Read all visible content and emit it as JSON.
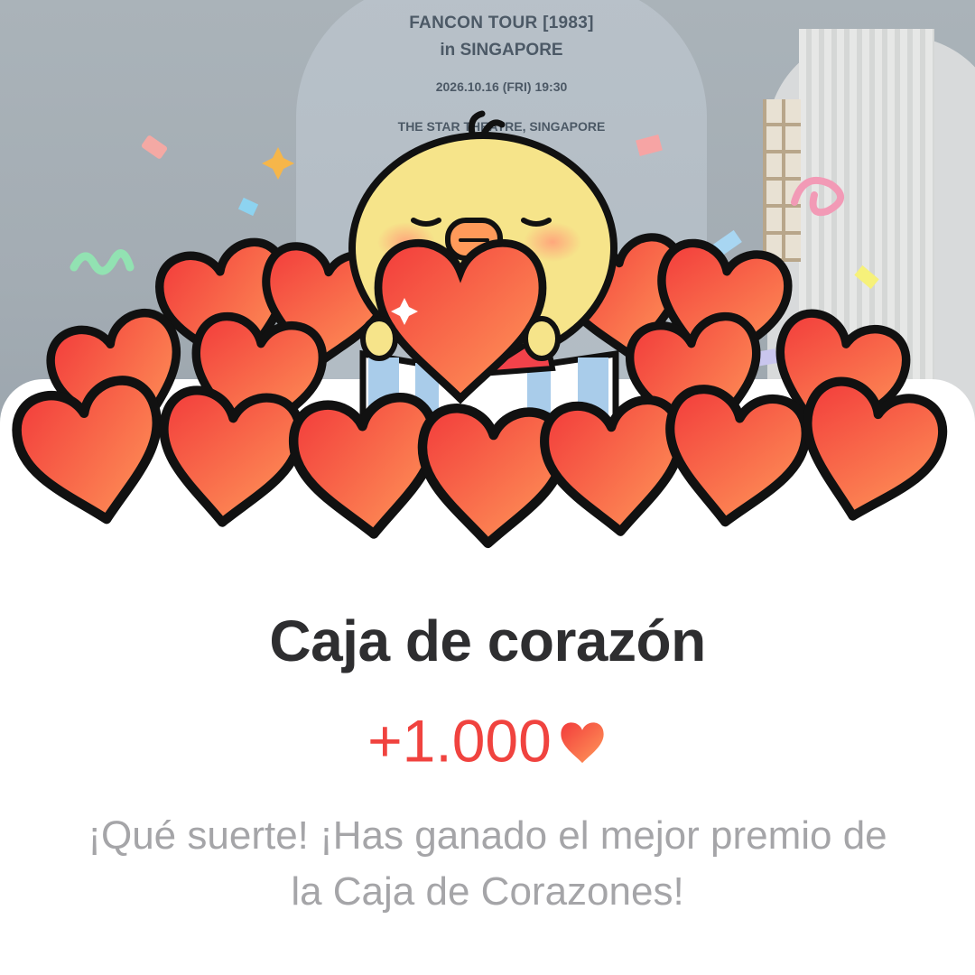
{
  "poster": {
    "title_line1": "FANCON TOUR [1983]",
    "title_line2": "in SINGAPORE",
    "date": "2026.10.16 (FRI) 19:30",
    "venue": "THE STAR THEATRE, SINGAPORE"
  },
  "popup": {
    "title": "Caja de corazón",
    "reward_amount": "+1.000",
    "reward_icon": "heart-icon",
    "message": "¡Qué suerte! ¡Has ganado el mejor premio de la Caja de Corazones!"
  },
  "colors": {
    "heart_light": "#ff9a5a",
    "heart_dark": "#f23b3b",
    "reward_text": "#f0433f",
    "title_text": "#2e2e30",
    "message_text": "#a5a5a8",
    "chick_body": "#f6e48a"
  }
}
